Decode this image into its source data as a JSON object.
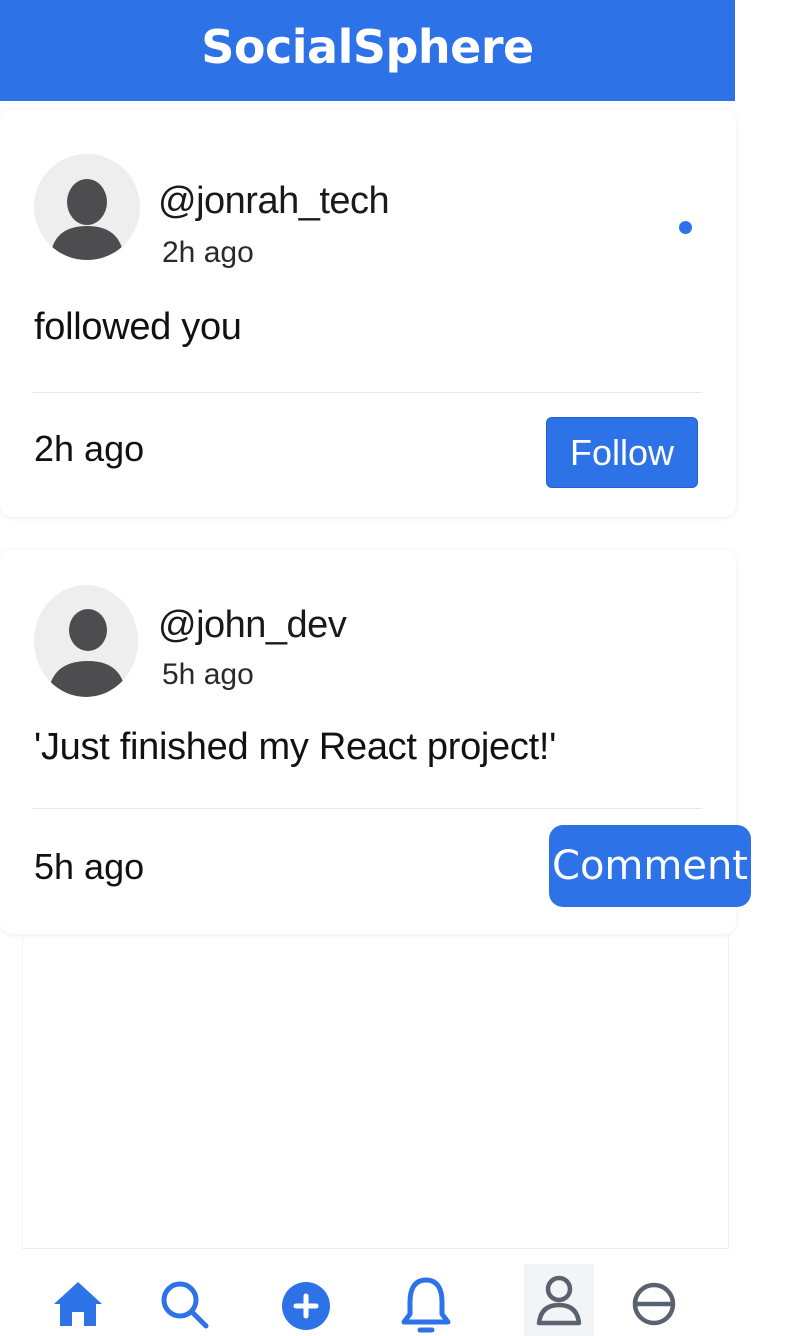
{
  "header": {
    "title": "SocialSphere"
  },
  "colors": {
    "accent": "#2e72e8",
    "avatar_bg": "#eeeeee",
    "avatar_fg": "#4d4d4f",
    "nav_inactive": "#5a6270"
  },
  "notifications": [
    {
      "username": "@jonrah_tech",
      "time": "2h ago",
      "text": "followed you",
      "footer_time": "2h ago",
      "action_label": "Follow",
      "unread": true
    },
    {
      "username": "@john_dev",
      "time": "5h ago",
      "text": "'Just finished my React project!'",
      "footer_time": "5h ago",
      "action_label": "Comment",
      "unread": false
    }
  ],
  "bottom_nav": {
    "items": [
      {
        "icon": "home-icon",
        "active": true
      },
      {
        "icon": "search-icon",
        "active": true
      },
      {
        "icon": "add-icon",
        "active": true
      },
      {
        "icon": "bell-icon",
        "active": true
      },
      {
        "icon": "profile-icon",
        "active": false
      },
      {
        "icon": "minus-circle-icon",
        "active": false
      }
    ]
  }
}
